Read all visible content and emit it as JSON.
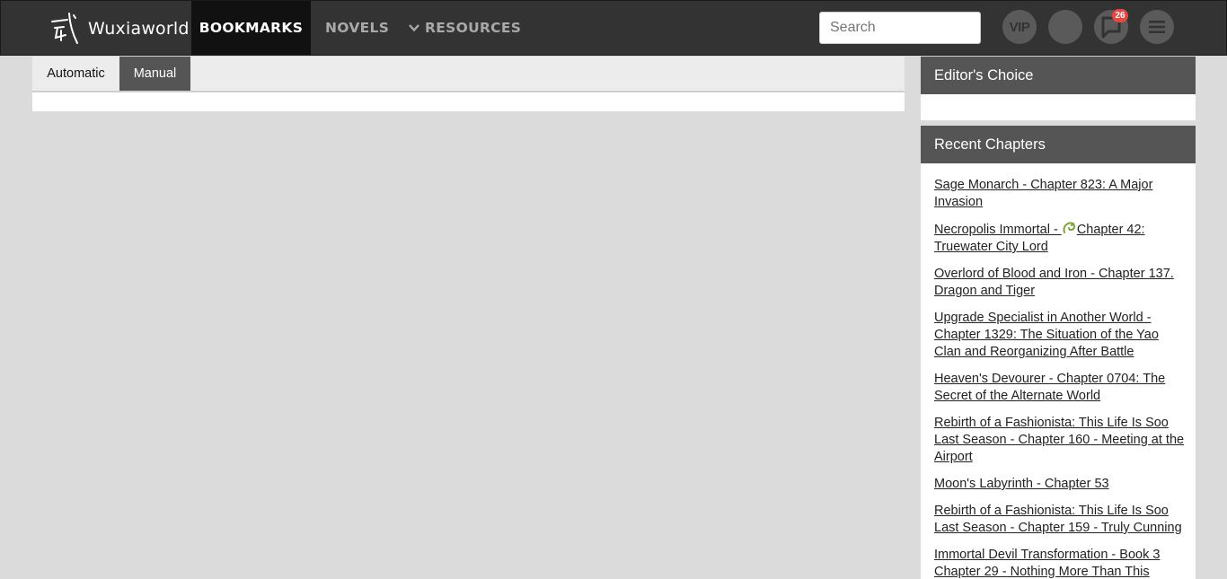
{
  "brand": {
    "name": "Wuxiaworld",
    "logo_icon": "wu-character-logo-icon"
  },
  "nav": {
    "bookmarks": "BOOKMARKS",
    "novels": "NOVELS",
    "resources": "RESOURCES"
  },
  "search": {
    "placeholder": "Search"
  },
  "header_buttons": {
    "vip_label": "VIP",
    "notification_count": "26"
  },
  "bookmark_tabs": [
    {
      "label": "Automatic",
      "active": false
    },
    {
      "label": "Manual",
      "active": true
    }
  ],
  "sidebar": {
    "editors_choice_title": "Editor's Choice",
    "recent_chapters_title": "Recent Chapters",
    "recent_chapters": [
      {
        "label": "Sage Monarch - Chapter 823: A Major Invasion"
      },
      {
        "prefix": "Necropolis Immortal - ",
        "label": "Chapter 42: Truewater City Lord",
        "icon": "dragon-icon"
      },
      {
        "label": "Overlord of Blood and Iron - Chapter 137. Dragon and Tiger"
      },
      {
        "label": "Upgrade Specialist in Another World - Chapter 1329: The Situation of the Yao Clan and Reorganizing After Battle"
      },
      {
        "label": "Heaven's Devourer - Chapter 0704: The Secret of the Alternate World"
      },
      {
        "label": "Rebirth of a Fashionista: This Life Is Soo Last Season - Chapter 160 - Meeting at the Airport"
      },
      {
        "label": "Moon's Labyrinth - Chapter 53"
      },
      {
        "label": "Rebirth of a Fashionista: This Life Is Soo Last Season - Chapter 159 - Truly Cunning"
      },
      {
        "label": "Immortal Devil Transformation - Book 3 Chapter 29 - Nothing More Than This"
      }
    ]
  },
  "colors": {
    "navbar": "#333333",
    "active_nav": "#111111",
    "page_bg": "#dbdbdb",
    "widget_header": "#555555",
    "badge": "#e8473f"
  }
}
